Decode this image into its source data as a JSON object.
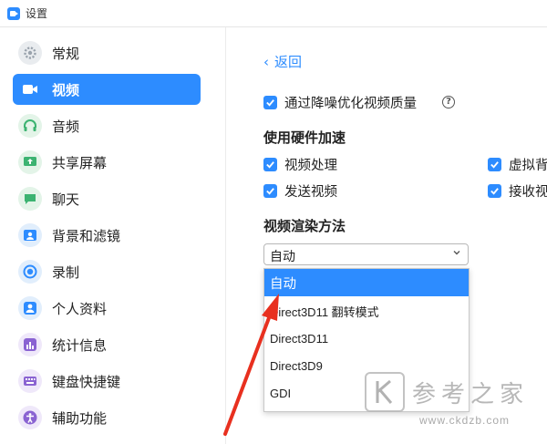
{
  "window": {
    "title": "设置"
  },
  "sidebar": {
    "items": [
      {
        "label": "常规",
        "icon": "gear-icon",
        "color": "#9aa3ad",
        "active": false
      },
      {
        "label": "视频",
        "icon": "video-camera-icon",
        "color": "#2d8cff",
        "active": true
      },
      {
        "label": "音频",
        "icon": "headphones-icon",
        "color": "#3cb371",
        "active": false
      },
      {
        "label": "共享屏幕",
        "icon": "share-screen-icon",
        "color": "#3cb371",
        "active": false
      },
      {
        "label": "聊天",
        "icon": "chat-bubble-icon",
        "color": "#3cb371",
        "active": false
      },
      {
        "label": "背景和滤镜",
        "icon": "background-icon",
        "color": "#2d8cff",
        "active": false
      },
      {
        "label": "录制",
        "icon": "record-icon",
        "color": "#2d8cff",
        "active": false
      },
      {
        "label": "个人资料",
        "icon": "user-profile-icon",
        "color": "#2d8cff",
        "active": false
      },
      {
        "label": "统计信息",
        "icon": "statistics-icon",
        "color": "#8a63d2",
        "active": false
      },
      {
        "label": "键盘快捷键",
        "icon": "keyboard-icon",
        "color": "#8a63d2",
        "active": false
      },
      {
        "label": "辅助功能",
        "icon": "accessibility-icon",
        "color": "#8a63d2",
        "active": false
      }
    ]
  },
  "main": {
    "back_label": "返回",
    "noise_option": {
      "label": "通过降噪优化视频质量",
      "checked": true
    },
    "hardware_section": {
      "title": "使用硬件加速",
      "options": [
        {
          "label": "视频处理",
          "checked": true
        },
        {
          "label": "虚拟背",
          "checked": true
        },
        {
          "label": "发送视频",
          "checked": true
        },
        {
          "label": "接收视",
          "checked": true
        }
      ]
    },
    "render_section": {
      "title": "视频渲染方法",
      "selected": "自动",
      "options": [
        "自动",
        "Direct3D11 翻转模式",
        "Direct3D11",
        "Direct3D9",
        "GDI"
      ]
    }
  },
  "watermark": {
    "text": "参考之家",
    "url": "www.ckdzb.com"
  },
  "colors": {
    "accent": "#2d8cff",
    "annotation": "#e8301f"
  }
}
